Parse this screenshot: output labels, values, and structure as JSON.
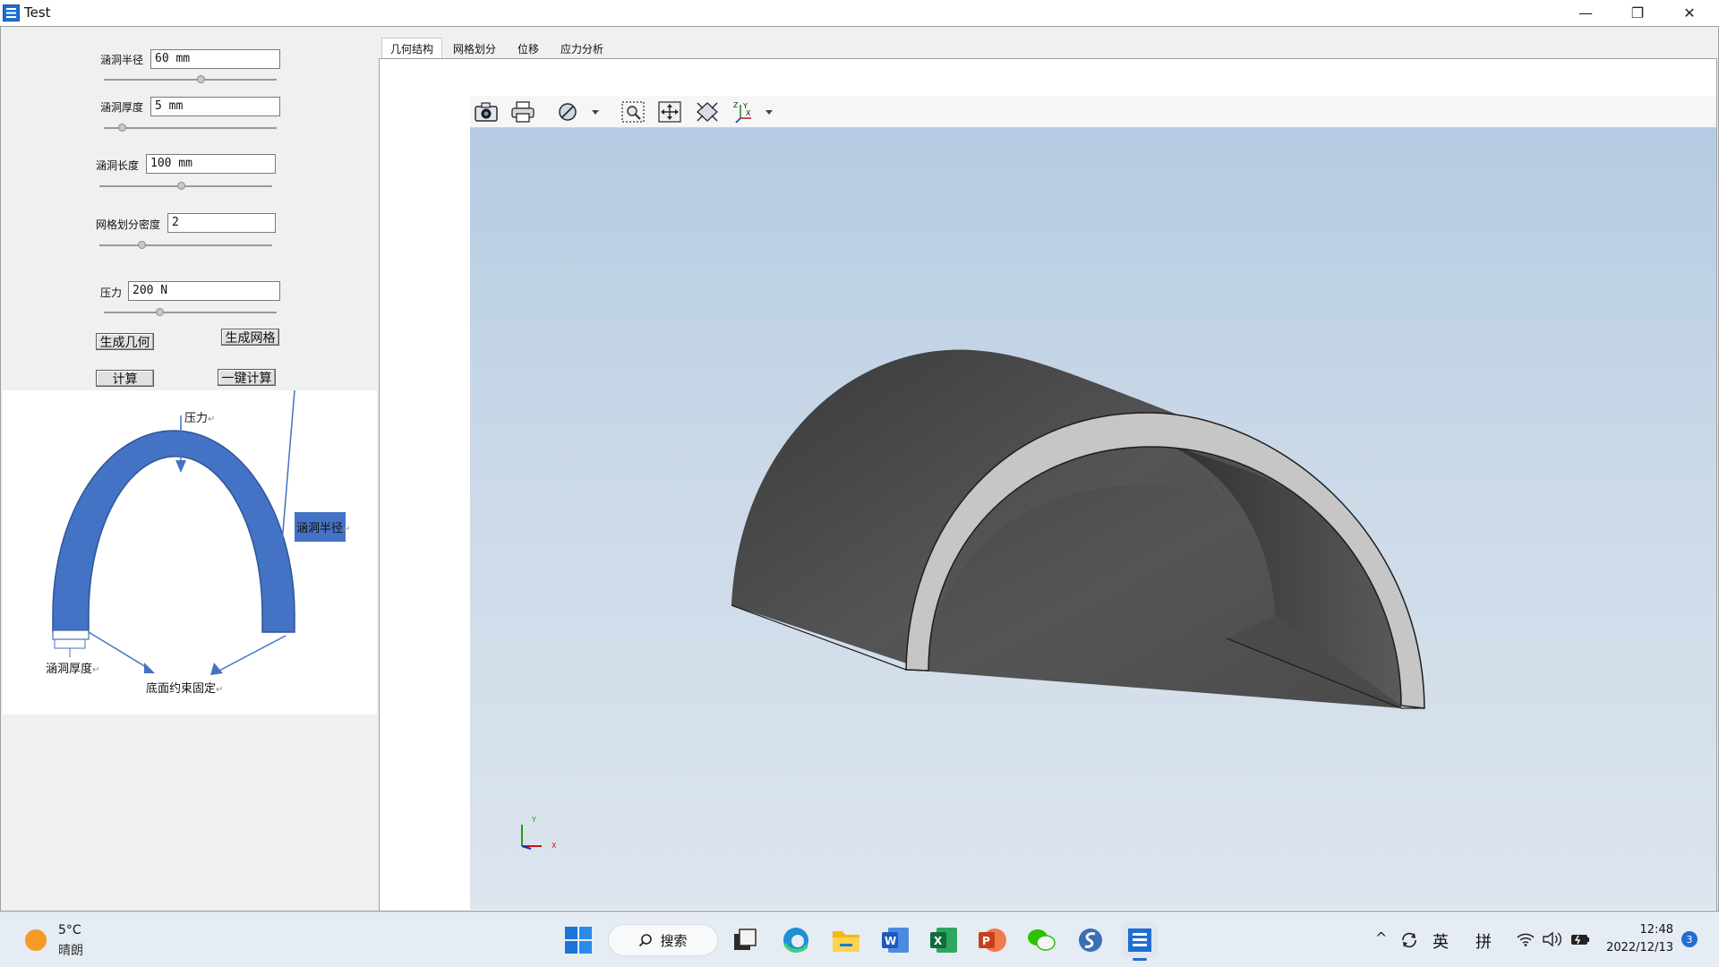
{
  "window": {
    "title": "Test",
    "buttons": {
      "minimize": "—",
      "restore": "❐",
      "close": "✕"
    }
  },
  "params": [
    {
      "label": "涵洞半径",
      "value": "60 mm",
      "slider": 0.57
    },
    {
      "label": "涵洞厚度",
      "value": "5 mm",
      "slider": 0.1
    },
    {
      "label": "涵洞长度",
      "value": "100 mm",
      "slider": 0.48
    },
    {
      "label": "网格划分密度",
      "value": "2",
      "slider": 0.25
    },
    {
      "label": "压力",
      "value": "200 N",
      "slider": 0.32
    }
  ],
  "buttons": {
    "gen_geometry": "生成几何",
    "gen_mesh": "生成网格",
    "compute": "计算",
    "one_click": "一键计算"
  },
  "diagram": {
    "pressure": "压力",
    "radius": "涵洞半径",
    "thickness": "涵洞厚度",
    "fixed": "底面约束固定",
    "para_mark": "↵"
  },
  "tabs": [
    "几何结构",
    "网格划分",
    "位移",
    "应力分析"
  ],
  "active_tab": 0,
  "viewer": {
    "tools": [
      "camera-icon",
      "print-icon",
      "display-mode-icon",
      "zoom-window-icon",
      "pan-icon",
      "fit-all-icon",
      "axis-view-icon"
    ],
    "triad": {
      "x": "X",
      "y": "Y"
    },
    "background_top": "#b4cbe3",
    "background_bottom": "#dde5ee",
    "shape_color": "#4a4a4a",
    "section_color": "#c8c8c8"
  },
  "taskbar": {
    "weather_temp": "5°C",
    "weather_desc": "晴朗",
    "search": "搜索",
    "time": "12:48",
    "date": "2022/12/13",
    "ime_lang": "英",
    "ime_mode": "拼",
    "notifications": "3",
    "apps": [
      "start-icon",
      "search-icon",
      "task-view-icon",
      "edge-icon",
      "file-explorer-icon",
      "word-icon",
      "excel-icon",
      "powerpoint-icon",
      "wechat-icon",
      "app-s-icon",
      "test-app-icon"
    ]
  }
}
